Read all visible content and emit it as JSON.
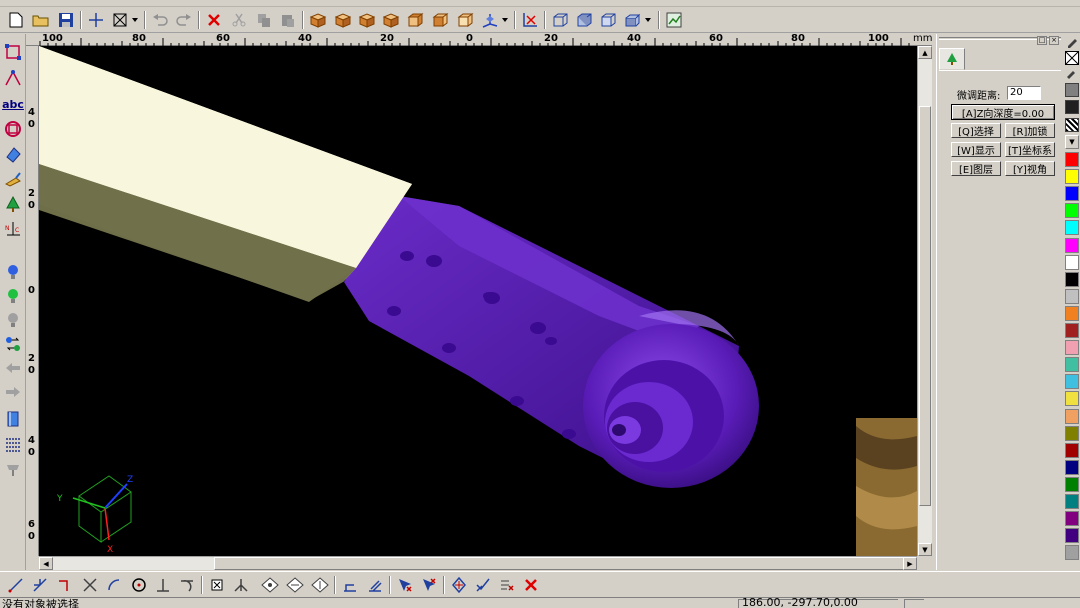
{
  "toolbar_top": {
    "icons": [
      "new-file-icon",
      "open-folder-icon",
      "save-icon",
      "crosshair-icon",
      "view-box-icon",
      "dropdown-icon",
      "undo-icon",
      "redo-icon",
      "delete-icon",
      "cut-icon",
      "copy-icon",
      "paste-icon",
      "box-view-1-icon",
      "box-view-2-icon",
      "box-view-3-icon",
      "box-view-4-icon",
      "box-view-5-icon",
      "box-view-6-icon",
      "axis-view-icon",
      "dropdown-icon",
      "no-selection-icon",
      "wire-box-1-icon",
      "wire-box-2-icon",
      "wire-box-3-icon",
      "wire-box-4-icon",
      "dropdown-icon",
      "map-icon"
    ]
  },
  "left_toolbar": {
    "icons": [
      "select-rect-icon",
      "pick-icon",
      "text-abc-icon",
      "ring-icon",
      "eraser-icon",
      "paint-icon",
      "tree-icon",
      "axis-label-icon",
      "bulb-blue-icon",
      "bulb-green-icon",
      "bulb-gray-icon",
      "transfer-icon",
      "arrow-left-icon",
      "arrow-right-icon",
      "book-icon",
      "grid-icon",
      "brush-icon"
    ],
    "abc_label": "abc"
  },
  "ruler": {
    "unit": "mm",
    "h_labels": [
      "100",
      "80",
      "60",
      "40",
      "20",
      "0",
      "20",
      "40",
      "60",
      "80",
      "100"
    ],
    "v_labels": [
      "4",
      "0",
      "2",
      "0",
      "0",
      "2",
      "0",
      "4",
      "0",
      "6",
      "0"
    ]
  },
  "viewport": {
    "background": "#000000",
    "model_color": "#5a1fb0",
    "neck_color": "#f8f6dc",
    "axis_labels": {
      "x": "X",
      "y": "Y",
      "z": "Z"
    }
  },
  "right_panel": {
    "fine_adjust_label": "微调距离:",
    "fine_adjust_value": "20",
    "depth_button": "[A]Z向深度=0.00",
    "buttons": [
      {
        "label": "[Q]选择",
        "name": "select-button"
      },
      {
        "label": "[R]加锁",
        "name": "lock-button"
      },
      {
        "label": "[W]显示",
        "name": "display-button"
      },
      {
        "label": "[T]坐标系",
        "name": "coordinate-button"
      },
      {
        "label": "[E]图层",
        "name": "layer-button"
      },
      {
        "label": "[Y]视角",
        "name": "view-angle-button"
      }
    ]
  },
  "palette": {
    "colors": [
      "#ff0000",
      "#ffff00",
      "#0000ff",
      "#00ff00",
      "#00ffff",
      "#ff00ff",
      "#ffffff",
      "#000000",
      "#c0c0c0",
      "#f08020",
      "#a02020",
      "#f0a0b0",
      "#40c0a0",
      "#40c0e0",
      "#f0e040",
      "#f0a060",
      "#808000",
      "#a00000",
      "#000080",
      "#008000",
      "#008080",
      "#800080",
      "#400080",
      "#a0a0a0"
    ]
  },
  "bottom_toolbar": {
    "icons": [
      "line-icon",
      "star-line-icon",
      "corner-icon",
      "cross-icon",
      "arc-icon",
      "circle-target-icon",
      "perpendicular-icon",
      "tangent-icon",
      "snap-point-icon",
      "angle-icon",
      "diamond-1-icon",
      "diamond-2-icon",
      "diamond-3-icon",
      "measure-1-icon",
      "measure-2-icon",
      "cursor-x-icon",
      "cursor-red-icon",
      "transform-icon",
      "cursor-check-icon",
      "edit-x-icon",
      "close-red-icon"
    ]
  },
  "status": {
    "message": "没有对象被选择",
    "coords": "186.00, -297.70,0.00"
  }
}
